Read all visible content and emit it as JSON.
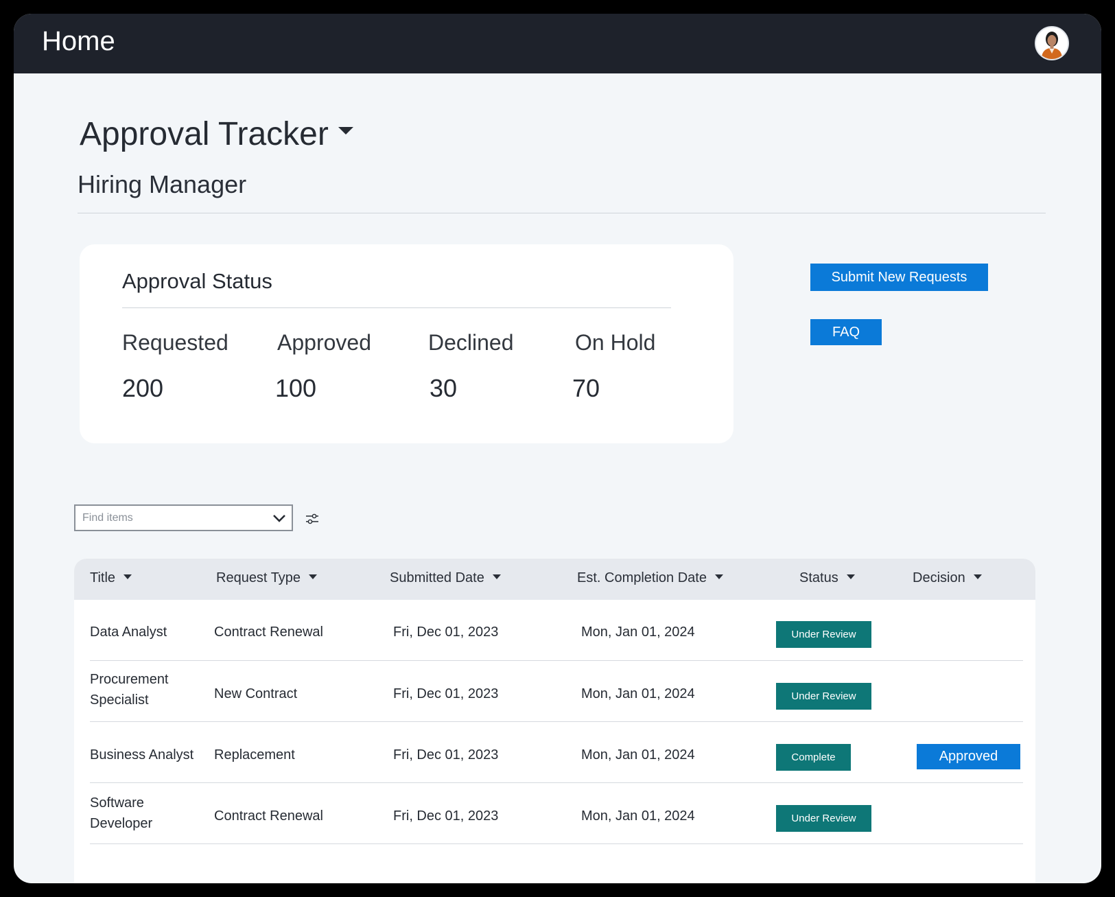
{
  "header": {
    "title": "Home",
    "avatar_icon": "user-avatar"
  },
  "page": {
    "title": "Approval Tracker",
    "subtitle": "Hiring Manager"
  },
  "approval_status": {
    "title": "Approval Status",
    "stats": [
      {
        "label": "Requested",
        "value": "200"
      },
      {
        "label": "Approved",
        "value": "100"
      },
      {
        "label": "Declined",
        "value": "30"
      },
      {
        "label": "On Hold",
        "value": "70"
      }
    ]
  },
  "actions": {
    "submit_label": "Submit New Requests",
    "faq_label": "FAQ"
  },
  "search": {
    "placeholder": "Find items"
  },
  "table": {
    "columns": [
      "Title",
      "Request Type",
      "Submitted Date",
      "Est. Completion Date",
      "Status",
      "Decision"
    ],
    "rows": [
      {
        "title": "Data Analyst",
        "request_type": "Contract Renewal",
        "submitted": "Fri, Dec 01, 2023",
        "completion": "Mon, Jan 01, 2024",
        "status": "Under Review",
        "decision": ""
      },
      {
        "title": "Procurement Specialist",
        "request_type": "New Contract",
        "submitted": "Fri, Dec 01, 2023",
        "completion": "Mon, Jan 01, 2024",
        "status": "Under Review",
        "decision": ""
      },
      {
        "title": "Business Analyst",
        "request_type": "Replacement",
        "submitted": "Fri, Dec 01, 2023",
        "completion": "Mon, Jan 01, 2024",
        "status": "Complete",
        "decision": "Approved"
      },
      {
        "title": "Software Developer",
        "request_type": "Contract Renewal",
        "submitted": "Fri, Dec 01, 2023",
        "completion": "Mon, Jan 01, 2024",
        "status": "Under Review",
        "decision": ""
      }
    ]
  },
  "colors": {
    "topbar": "#1e222b",
    "primary_button": "#0b7ad8",
    "status_badge": "#0e7777",
    "background": "#f3f6f9"
  }
}
